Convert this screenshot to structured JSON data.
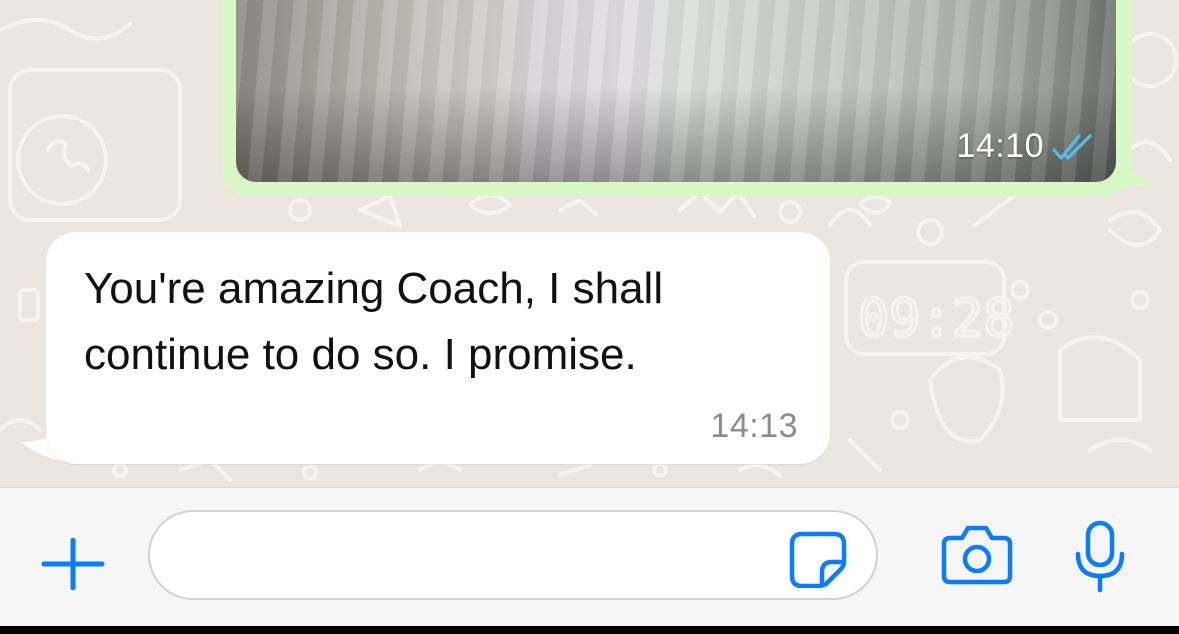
{
  "messages": [
    {
      "direction": "outgoing",
      "type": "image",
      "time": "14:10",
      "status_icon": "double-check-read-icon",
      "status_color": "#53bdeb"
    },
    {
      "direction": "incoming",
      "type": "text",
      "text": "You're amazing Coach, I shall continue to do so. I promise.",
      "time": "14:13"
    }
  ],
  "input_bar": {
    "placeholder": "",
    "icons": [
      "plus-icon",
      "sticker-icon",
      "camera-icon",
      "microphone-icon"
    ],
    "accent_color": "#0a7cff"
  },
  "colors": {
    "chat_background": "#ebe7e0",
    "outgoing_bubble": "#d8f9c6",
    "incoming_bubble": "#ffffff"
  }
}
